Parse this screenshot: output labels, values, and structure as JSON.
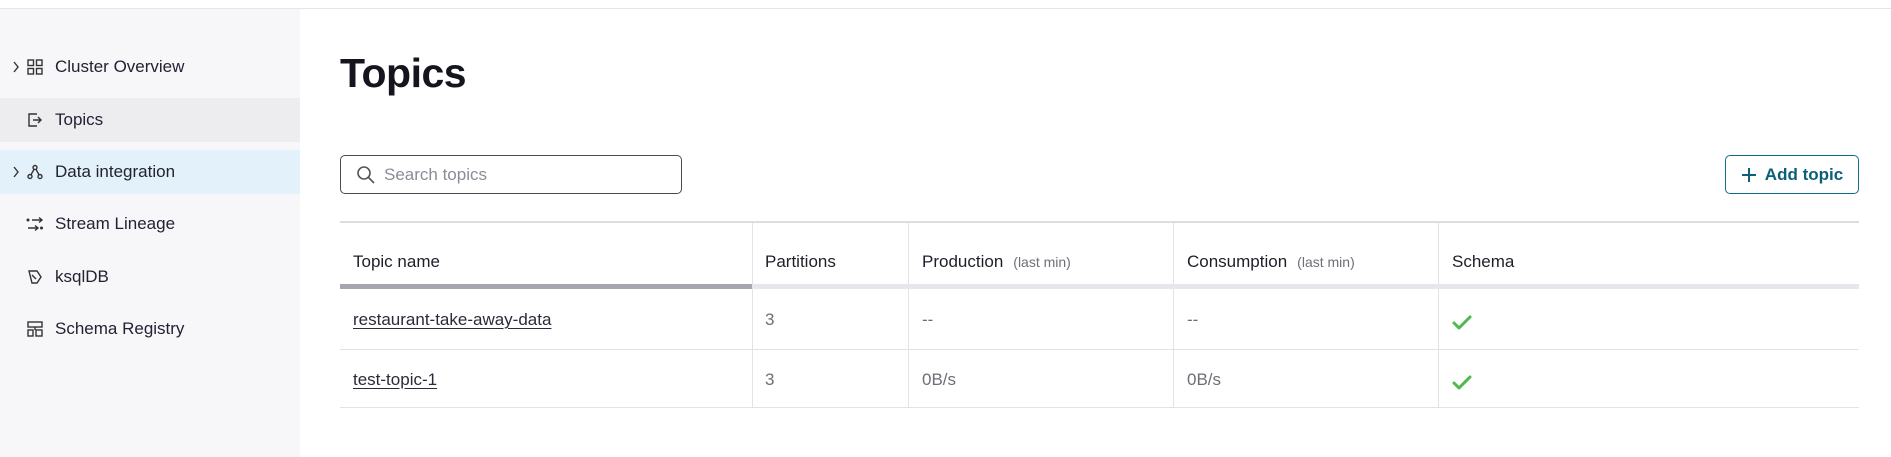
{
  "sidebar": {
    "items": [
      {
        "label": "Cluster Overview",
        "icon": "grid-icon",
        "expandable": true,
        "state": "normal"
      },
      {
        "label": "Topics",
        "icon": "topics-icon",
        "expandable": false,
        "state": "active"
      },
      {
        "label": "Data integration",
        "icon": "connectors-icon",
        "expandable": true,
        "state": "hover"
      },
      {
        "label": "Stream Lineage",
        "icon": "lineage-icon",
        "expandable": false,
        "state": "normal"
      },
      {
        "label": "ksqlDB",
        "icon": "ksqldb-icon",
        "expandable": false,
        "state": "normal"
      },
      {
        "label": "Schema Registry",
        "icon": "schema-registry-icon",
        "expandable": false,
        "state": "normal"
      }
    ]
  },
  "page": {
    "title": "Topics"
  },
  "search": {
    "placeholder": "Search topics",
    "value": ""
  },
  "actions": {
    "add_topic_label": "Add topic"
  },
  "table": {
    "columns": [
      {
        "label": "Topic name",
        "sub": ""
      },
      {
        "label": "Partitions",
        "sub": ""
      },
      {
        "label": "Production",
        "sub": "(last min)"
      },
      {
        "label": "Consumption",
        "sub": "(last min)"
      },
      {
        "label": "Schema",
        "sub": ""
      }
    ],
    "sorted_column": "Topic name",
    "rows": [
      {
        "name": "restaurant-take-away-data",
        "partitions": "3",
        "production": "--",
        "consumption": "--",
        "schema": "check"
      },
      {
        "name": "test-topic-1",
        "partitions": "3",
        "production": "0B/s",
        "consumption": "0B/s",
        "schema": "check"
      }
    ]
  },
  "colors": {
    "accent": "#0c5f7a",
    "sidebar_bg": "#f7f7f9",
    "sidebar_active": "#ededf0",
    "sidebar_hover": "#e3f1fa",
    "schema_ok": "#4cba4c"
  }
}
